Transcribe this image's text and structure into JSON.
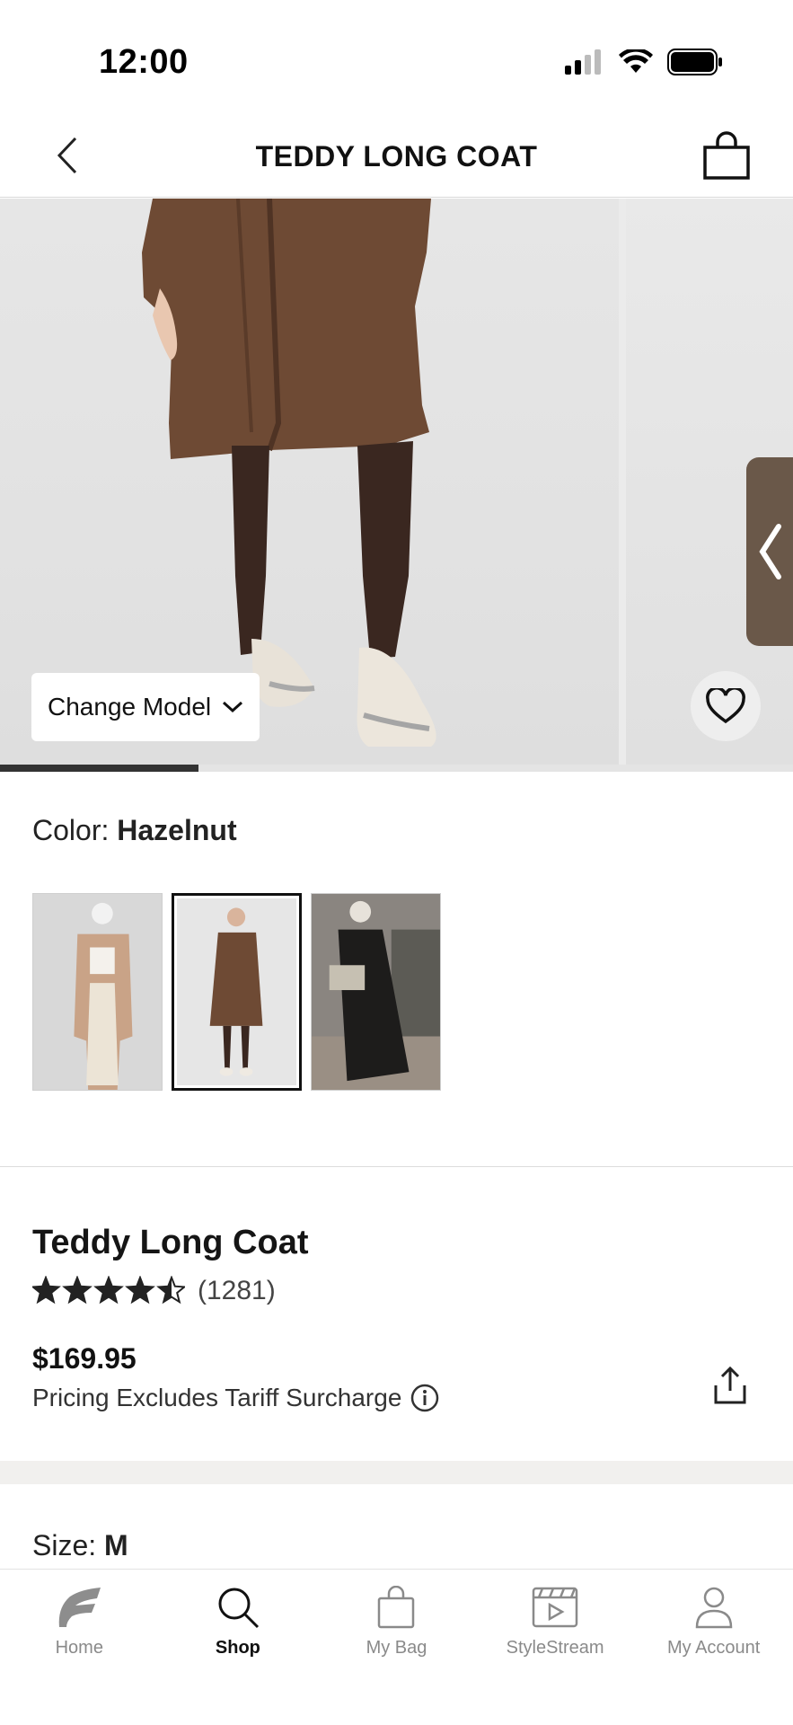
{
  "status_bar": {
    "time": "12:00"
  },
  "header": {
    "title": "TEDDY LONG COAT"
  },
  "gallery": {
    "change_model_label": "Change Model",
    "progress": 0.25
  },
  "color": {
    "label": "Color: ",
    "value": "Hazelnut",
    "selected_index": 1
  },
  "product": {
    "name": "Teddy Long Coat",
    "rating": 4.5,
    "review_count": "(1281)",
    "price": "$169.95",
    "tariff_note": "Pricing Excludes Tariff Surcharge"
  },
  "size": {
    "label": "Size: ",
    "value": "M"
  },
  "tab_bar": {
    "active": "Shop",
    "tabs": [
      {
        "label": "Home",
        "icon": "brand-logo-icon"
      },
      {
        "label": "Shop",
        "icon": "search-icon"
      },
      {
        "label": "My Bag",
        "icon": "bag-icon"
      },
      {
        "label": "StyleStream",
        "icon": "video-clapper-icon"
      },
      {
        "label": "My Account",
        "icon": "person-icon"
      }
    ]
  },
  "colors": {
    "coat_brown": "#6b4630",
    "selected_border": "#111111",
    "inactive_tab": "#8a8a8a"
  }
}
